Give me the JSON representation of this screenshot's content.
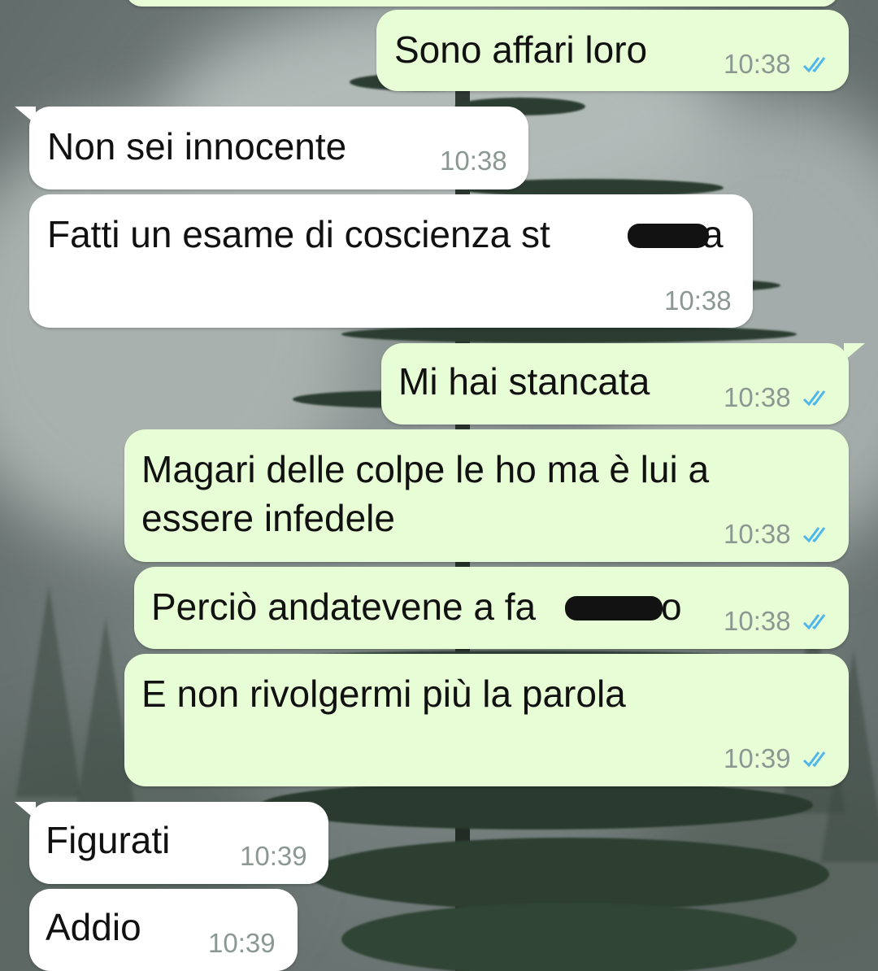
{
  "chat": {
    "messages": [
      {
        "direction": "out",
        "text": "Sono affari loro",
        "time": "10:38",
        "status": "double-check-read"
      },
      {
        "direction": "in",
        "text": "Non sei innocente",
        "time": "10:38"
      },
      {
        "direction": "in",
        "text": "Fatti un esame di coscienza st",
        "text_tail": "a",
        "redacted": true,
        "time": "10:38"
      },
      {
        "direction": "out",
        "text": "Mi hai stancata",
        "time": "10:38",
        "status": "double-check-read"
      },
      {
        "direction": "out",
        "text_line1": "Magari delle colpe le ho ma è lui a",
        "text_line2": "essere infedele",
        "time": "10:38",
        "status": "double-check-read"
      },
      {
        "direction": "out",
        "text": "Perciò andatevene a fa",
        "text_tail": "o",
        "redacted": true,
        "time": "10:38",
        "status": "double-check-read"
      },
      {
        "direction": "out",
        "text": "E non rivolgermi più la parola",
        "time": "10:39",
        "status": "double-check-read"
      },
      {
        "direction": "in",
        "text": "Figurati",
        "time": "10:39"
      },
      {
        "direction": "in",
        "text": "Addio",
        "time": "10:39"
      }
    ]
  },
  "colors": {
    "outgoing_bubble": "#e7fdd6",
    "incoming_bubble": "#ffffff",
    "read_ticks": "#4fb6ec",
    "timestamp": "#8b9892"
  },
  "icons": {
    "read_receipt": "double-check-icon",
    "redaction": "redaction-mark"
  }
}
